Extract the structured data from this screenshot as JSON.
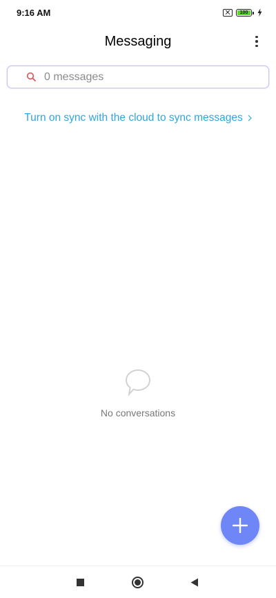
{
  "status_bar": {
    "time": "9:16 AM",
    "battery_level": "100",
    "icons": [
      "no-sim-icon",
      "battery-icon",
      "charging-bolt-icon"
    ]
  },
  "header": {
    "title": "Messaging",
    "more_icon": "more-vert-icon"
  },
  "search": {
    "placeholder": "0 messages",
    "icon": "search-icon"
  },
  "sync_banner": {
    "text": "Turn on sync with the cloud to sync messages"
  },
  "empty_state": {
    "icon": "chat-bubble-icon",
    "text": "No conversations"
  },
  "fab": {
    "icon": "plus-icon"
  },
  "nav_bar": {
    "icons": [
      "recents-square-icon",
      "home-circle-icon",
      "back-triangle-icon"
    ]
  },
  "colors": {
    "accent": "#6f86f6",
    "link": "#2fa5e0",
    "search_icon": "#e0585c",
    "search_border": "#c7c3f3",
    "battery_fill": "#5cd62a"
  }
}
